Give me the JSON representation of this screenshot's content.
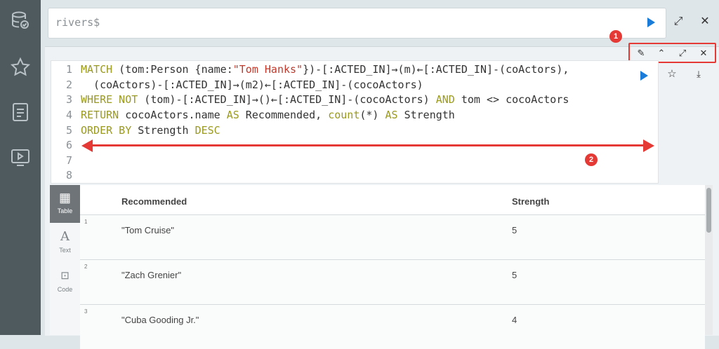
{
  "editor": {
    "prompt": "rivers$"
  },
  "icons": {
    "database": "database-icon",
    "star": "star-icon",
    "document": "document-icon",
    "play_video": "video-play-icon",
    "run": "play-icon",
    "maximize": "expand-icon",
    "close": "close-icon",
    "pin": "pin-icon",
    "collapse": "chevron-up-icon",
    "fullscreen": "fullscreen-icon",
    "favorite": "star-outline-icon",
    "download": "download-icon"
  },
  "annotations": {
    "badge1": "1",
    "badge2": "2"
  },
  "code_lines": [
    {
      "num": "1"
    },
    {
      "num": "2"
    },
    {
      "num": "3"
    },
    {
      "num": "4"
    },
    {
      "num": "5"
    },
    {
      "num": "6"
    },
    {
      "num": "7"
    },
    {
      "num": "8"
    }
  ],
  "code": {
    "l1a": "MATCH",
    "l1b": " (tom:Person {name:",
    "l1c": "\"Tom Hanks\"",
    "l1d": "})-[:ACTED_IN]→(m)←[:ACTED_IN]-(coActors),",
    "l2": "  (coActors)-[:ACTED_IN]→(m2)←[:ACTED_IN]-(cocoActors)",
    "l3a": "WHERE NOT",
    "l3b": " (tom)-[:ACTED_IN]→()←[:ACTED_IN]-(cocoActors) ",
    "l3c": "AND",
    "l3d": " tom <> cocoActors",
    "l4a": "RETURN",
    "l4b": " cocoActors.name ",
    "l4c": "AS",
    "l4d": " Recommended, ",
    "l4e": "count",
    "l4f": "(*) ",
    "l4g": "AS",
    "l4h": " Strength",
    "l5a": "ORDER BY",
    "l5b": " Strength ",
    "l5c": "DESC"
  },
  "view_tabs": [
    {
      "label": "Table",
      "icon": "table-icon",
      "active": true
    },
    {
      "label": "Text",
      "icon": "text-icon",
      "active": false
    },
    {
      "label": "Code",
      "icon": "code-icon",
      "active": false
    }
  ],
  "table": {
    "columns": [
      "Recommended",
      "Strength"
    ],
    "rows": [
      {
        "num": "1",
        "recommended": "\"Tom Cruise\"",
        "strength": "5"
      },
      {
        "num": "2",
        "recommended": "\"Zach Grenier\"",
        "strength": "5"
      },
      {
        "num": "3",
        "recommended": "\"Cuba Gooding Jr.\"",
        "strength": "4"
      }
    ]
  },
  "colors": {
    "sidebar": "#4f5a5f",
    "accent": "#1a7bd8",
    "annotation": "#e53935",
    "keyword": "#9a9a20",
    "string": "#c0392b"
  }
}
